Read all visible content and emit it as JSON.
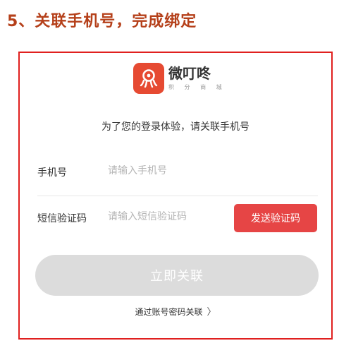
{
  "step_title": "5、关联手机号，完成绑定",
  "brand": {
    "name": "微叮咚",
    "tagline": "积 分 商 城",
    "logo_color": "#e64a32"
  },
  "subtitle": "为了您的登录体验，请关联手机号",
  "phone": {
    "label": "手机号",
    "placeholder": "请输入手机号"
  },
  "sms": {
    "label": "短信验证码",
    "placeholder": "请输入短信验证码",
    "send_label": "发送验证码"
  },
  "submit_label": "立即关联",
  "switch_link": {
    "label": "通过账号密码关联",
    "icon": "chevron-right-icon"
  },
  "colors": {
    "accent": "#e64545",
    "title": "#b5401a",
    "frame": "#e0201f",
    "disabled": "#dcdcdc"
  }
}
